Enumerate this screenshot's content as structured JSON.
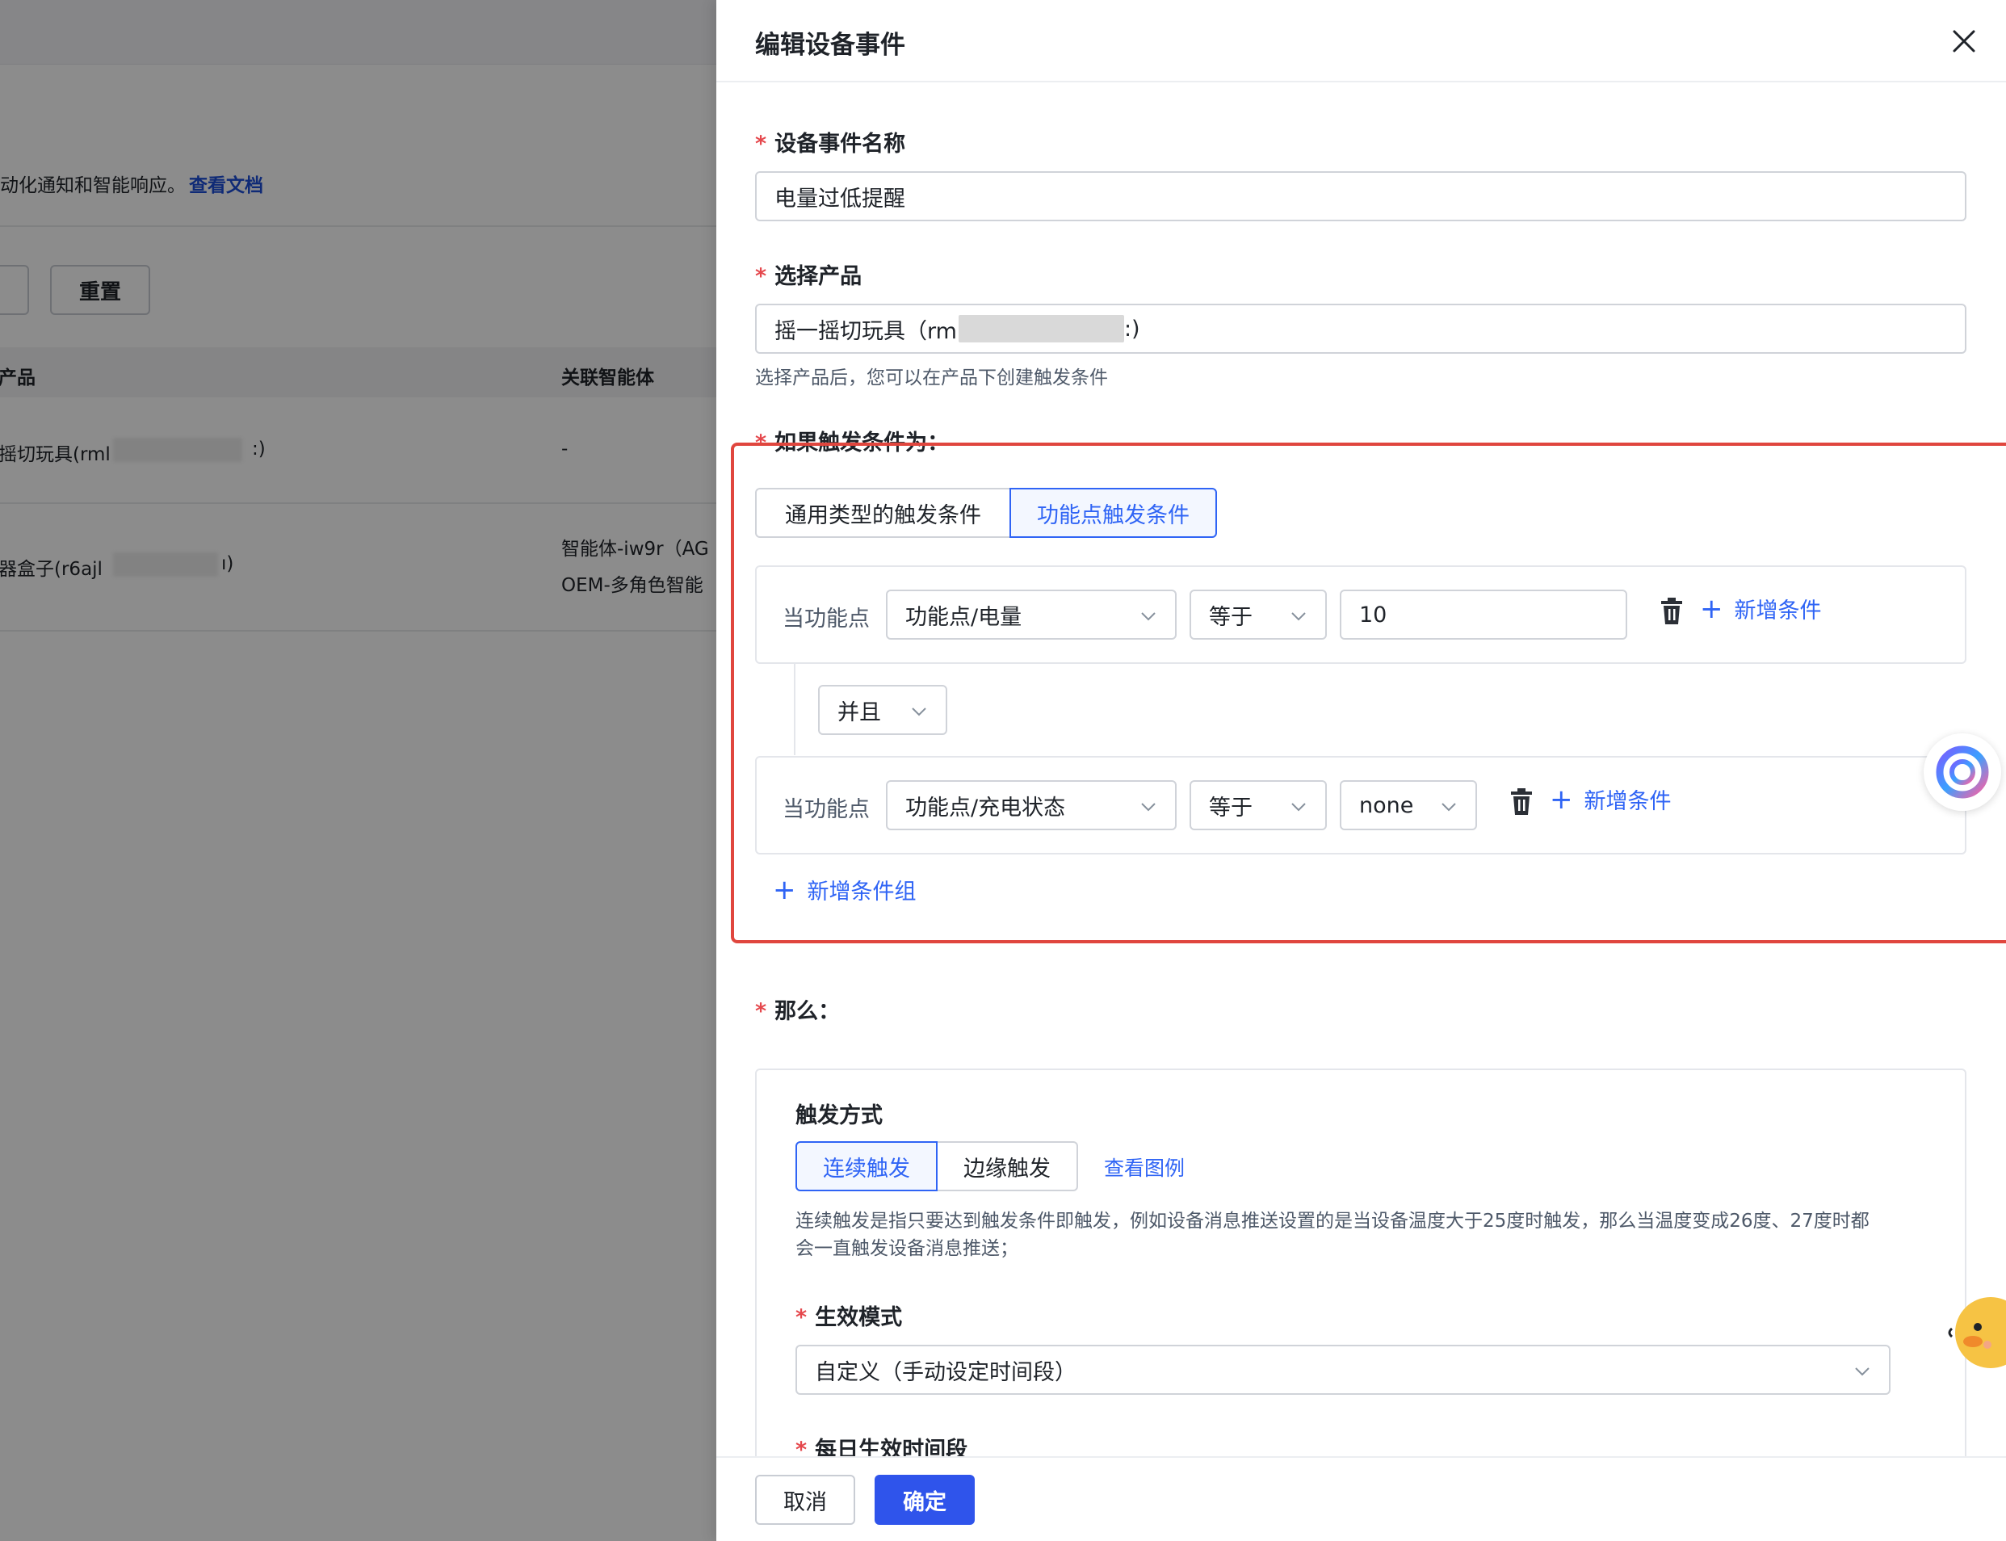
{
  "background": {
    "description_text": "动化通知和智能响应。",
    "doc_link": "查看文档",
    "reset_button": "重置",
    "table_headers": [
      "产品",
      "关联智能体"
    ],
    "rows": [
      {
        "product": "摇切玩具(rml",
        "product_suffix": ":)",
        "agent_line1": "-",
        "agent_line2": ""
      },
      {
        "product": "器盒子(r6ajl",
        "product_suffix": "ı)",
        "agent_line1": "智能体-iw9r（AG",
        "agent_line2": "OEM-多角色智能"
      }
    ]
  },
  "drawer": {
    "title": "编辑设备事件",
    "event_name": {
      "label": "设备事件名称",
      "value": "电量过低提醒"
    },
    "product": {
      "label": "选择产品",
      "value_prefix": "摇一摇切玩具（rm",
      "value_suffix": ":)",
      "hint": "选择产品后，您可以在产品下创建触发条件"
    },
    "trigger": {
      "label": "如果触发条件为：",
      "tabs": [
        "通用类型的触发条件",
        "功能点触发条件"
      ],
      "active_tab": 1,
      "conditions": [
        {
          "prefix": "当功能点",
          "field": "功能点/电量",
          "operator": "等于",
          "value": "10",
          "add_label": "新增条件"
        },
        {
          "prefix": "当功能点",
          "field": "功能点/充电状态",
          "operator": "等于",
          "value": "none",
          "add_label": "新增条件"
        }
      ],
      "logic": "并且",
      "add_group_label": "新增条件组"
    },
    "then": {
      "label": "那么：",
      "mode_title": "触发方式",
      "modes": [
        "连续触发",
        "边缘触发"
      ],
      "active_mode": 0,
      "example_link": "查看图例",
      "explanation": "连续触发是指只要达到触发条件即触发，例如设备消息推送设置的是当设备温度大于25度时触发，那么当温度变成26度、27度时都会一直触发设备消息推送；",
      "effect_mode_label": "生效模式",
      "effect_mode_value": "自定义（手动设定时间段）",
      "daily_label": "每日生效时间段"
    },
    "footer": {
      "cancel": "取消",
      "confirm": "确定"
    }
  },
  "colors": {
    "primary": "#2f64f5",
    "confirm_button": "#2f54eb",
    "required": "#e5484d",
    "highlight_box": "#e0463e"
  },
  "icons": [
    "close-icon",
    "trash-icon",
    "plus-icon",
    "chevron-down-icon",
    "ai-assistant-icon",
    "duck-mascot-icon"
  ]
}
